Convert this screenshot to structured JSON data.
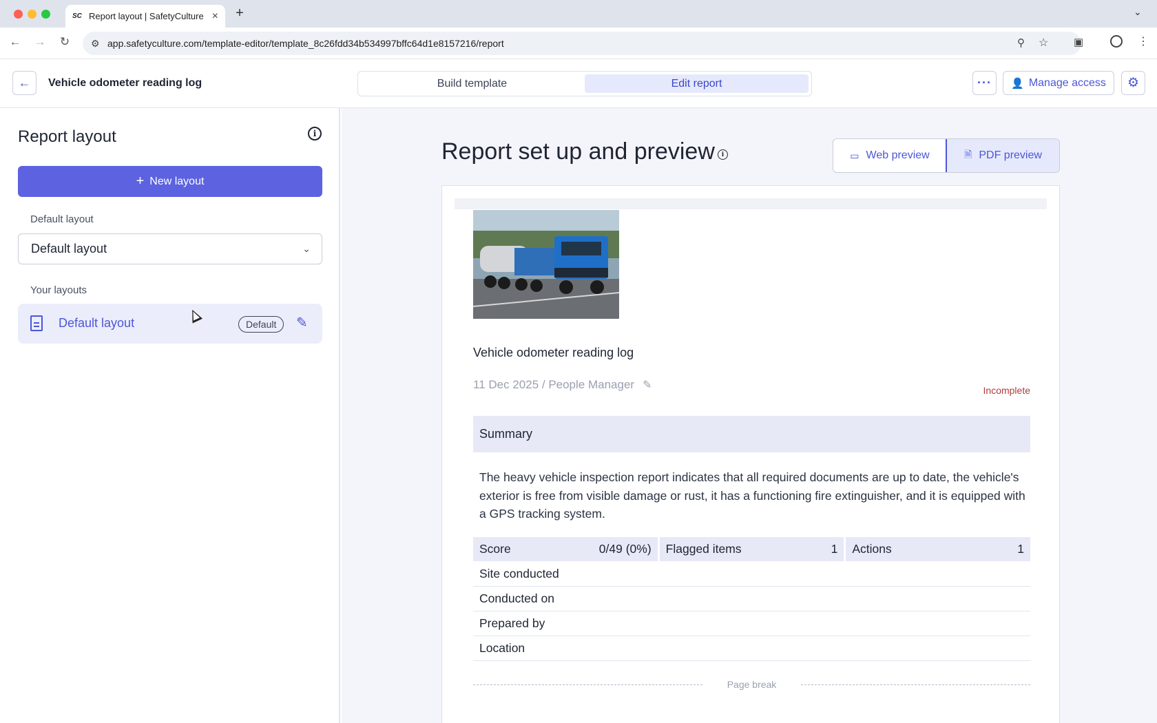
{
  "browser": {
    "tab_title": "Report layout | SafetyCulture",
    "favicon_text": "SC",
    "url": "app.safetyculture.com/template-editor/template_8c26fdd34b534997bffc64d1e8157216/report"
  },
  "header": {
    "template_title": "Vehicle odometer reading log",
    "modes": [
      "Build template",
      "Edit report"
    ],
    "active_mode": "Edit report",
    "manage_access_label": "Manage access"
  },
  "sidebar": {
    "title": "Report layout",
    "new_layout_label": "New layout",
    "default_layout_label": "Default layout",
    "default_layout_value": "Default layout",
    "your_layouts_label": "Your layouts",
    "layouts": [
      {
        "name": "Default layout",
        "badge": "Default"
      }
    ]
  },
  "main": {
    "title": "Report set up and preview",
    "preview_options": [
      "Web preview",
      "PDF preview"
    ],
    "active_preview": "PDF preview",
    "report": {
      "title": "Vehicle odometer reading log",
      "subtitle": "11 Dec 2025 / People Manager",
      "status": "Incomplete",
      "summary_heading": "Summary",
      "summary_text": "The heavy vehicle inspection report indicates that all required documents are up to date, the vehicle's exterior is free from visible damage or rust, it has a functioning fire extinguisher, and it is equipped with a GPS tracking system.",
      "stats": [
        {
          "label": "Score",
          "value": "0/49 (0%)"
        },
        {
          "label": "Flagged items",
          "value": "1"
        },
        {
          "label": "Actions",
          "value": "1"
        }
      ],
      "fields": [
        "Site conducted",
        "Conducted on",
        "Prepared by",
        "Location"
      ],
      "page_break_label": "Page break"
    }
  },
  "colors": {
    "accent": "#5c62e0",
    "status_incomplete": "#b23a3a"
  }
}
